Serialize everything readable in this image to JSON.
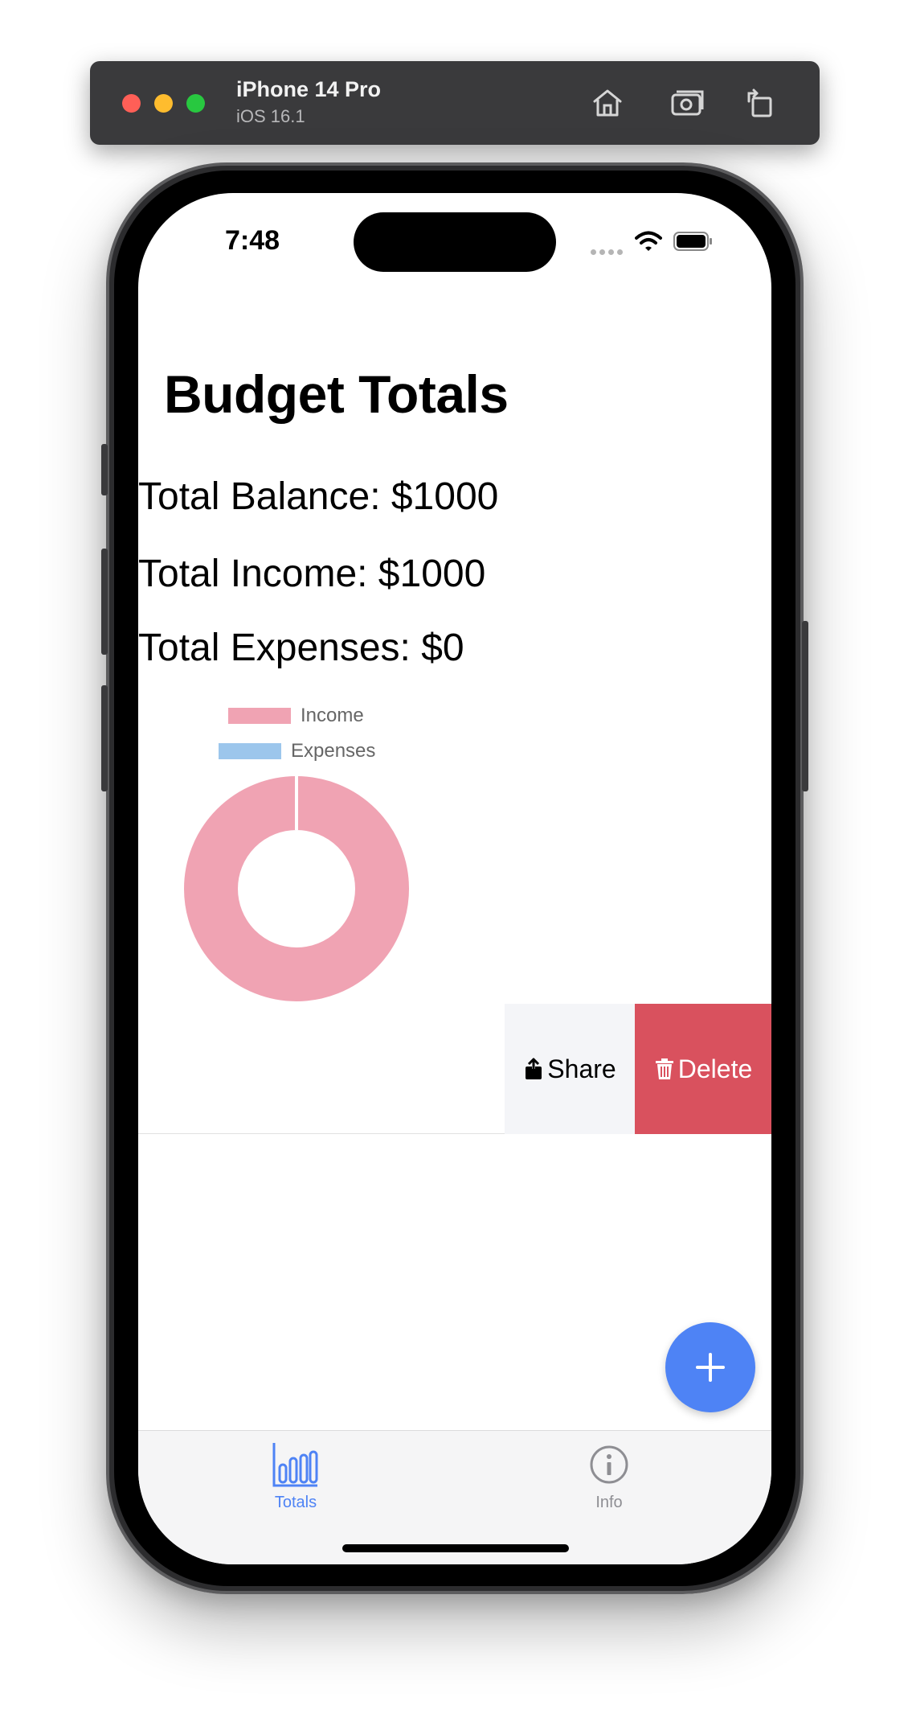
{
  "simulator": {
    "device_name": "iPhone 14 Pro",
    "os_version": "iOS 16.1"
  },
  "status_bar": {
    "time": "7:48"
  },
  "page": {
    "title": "Budget Totals"
  },
  "totals": {
    "balance": "Total Balance: $1000",
    "income": "Total Income: $1000",
    "expenses": "Total Expenses: $0"
  },
  "chart_data": {
    "type": "pie",
    "variant": "doughnut",
    "legend": [
      {
        "label": "Income",
        "color": "#f0a3b3"
      },
      {
        "label": "Expenses",
        "color": "#9cc6ec"
      }
    ],
    "values": [
      1000,
      0
    ],
    "categories": [
      "Income",
      "Expenses"
    ],
    "legend_position": "top"
  },
  "swipe_actions": {
    "share": "Share",
    "delete": "Delete",
    "share_icon": "share-icon",
    "delete_icon": "trash-icon"
  },
  "fab": {
    "icon": "plus-icon"
  },
  "tabbar": {
    "tabs": [
      {
        "label": "Totals",
        "icon": "bar-chart-icon",
        "active": true
      },
      {
        "label": "Info",
        "icon": "info-icon",
        "active": false
      }
    ]
  },
  "colors": {
    "accent": "#4e83f5",
    "delete": "#d9515e",
    "income": "#f0a3b3",
    "expenses": "#9cc6ec"
  }
}
